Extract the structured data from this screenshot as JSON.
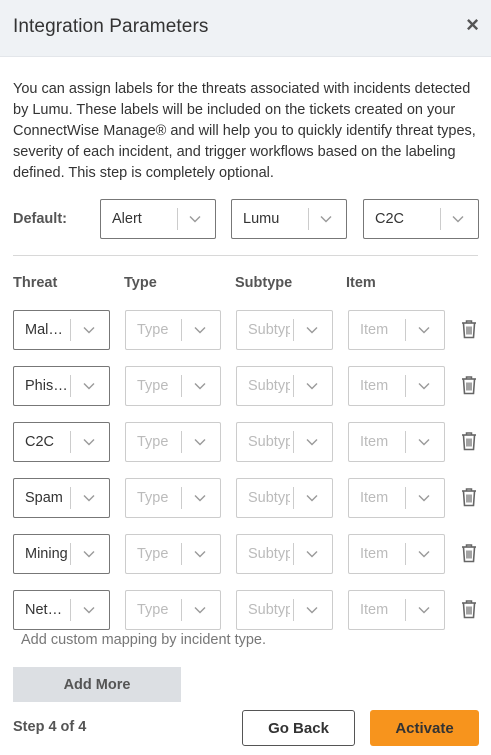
{
  "dialog": {
    "title": "Integration Parameters",
    "close_symbol": "×"
  },
  "intro_text": "You can assign labels for the threats associated with incidents detected by Lumu. These labels will be included on the tickets created on your ConnectWise Manage® and will help you to quickly identify threat types, severity of each incident, and trigger workflows based on the labeling defined. This step is completely optional.",
  "defaults": {
    "label": "Default:",
    "selects": [
      "Alert",
      "Lumu",
      "C2C"
    ]
  },
  "columns": [
    "Threat",
    "Type",
    "Subtype",
    "Item"
  ],
  "placeholders": {
    "type": "Type",
    "subtype": "Subtype",
    "item": "Item"
  },
  "rows": [
    {
      "threat": "Mal…"
    },
    {
      "threat": "Phis…"
    },
    {
      "threat": "C2C"
    },
    {
      "threat": "Spam"
    },
    {
      "threat": "Mining"
    },
    {
      "threat": "Net…"
    }
  ],
  "hint": "Add custom mapping by incident type.",
  "add_more_label": "Add More",
  "step_label": "Step 4 of 4",
  "go_back_label": "Go Back",
  "activate_label": "Activate",
  "icons": {
    "close": "close-icon",
    "chevron": "chevron-down-icon",
    "trash": "trash-icon"
  },
  "colors": {
    "header_bg": "#eff2f5",
    "accent": "#f7941d",
    "button_grey": "#dcdfe3"
  }
}
